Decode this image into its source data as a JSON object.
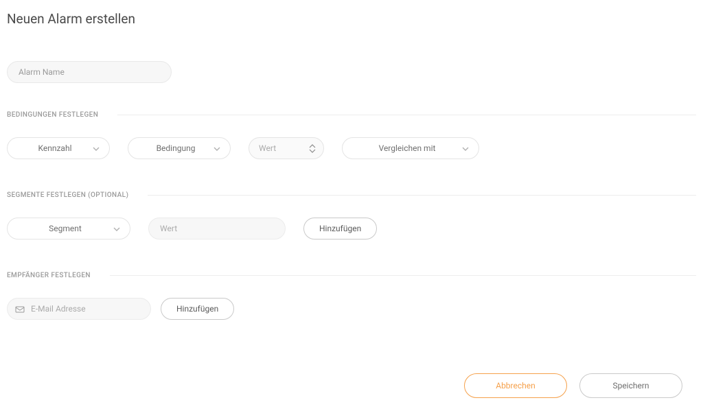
{
  "title": "Neuen Alarm erstellen",
  "alarm_name": {
    "placeholder": "Alarm Name",
    "value": ""
  },
  "sections": {
    "conditions": {
      "label": "BEDINGUNGEN FESTLEGEN",
      "metric_dropdown": "Kennzahl",
      "condition_dropdown": "Bedingung",
      "value_placeholder": "Wert",
      "compare_dropdown": "Vergleichen mit"
    },
    "segments": {
      "label": "SEGMENTE FESTLEGEN (OPTIONAL)",
      "segment_dropdown": "Segment",
      "value_placeholder": "Wert",
      "add_button": "Hinzufügen"
    },
    "recipients": {
      "label": "EMPFÄNGER FESTLEGEN",
      "email_placeholder": "E-Mail Adresse",
      "add_button": "Hinzufügen"
    }
  },
  "footer": {
    "cancel": "Abbrechen",
    "save": "Speichern"
  }
}
